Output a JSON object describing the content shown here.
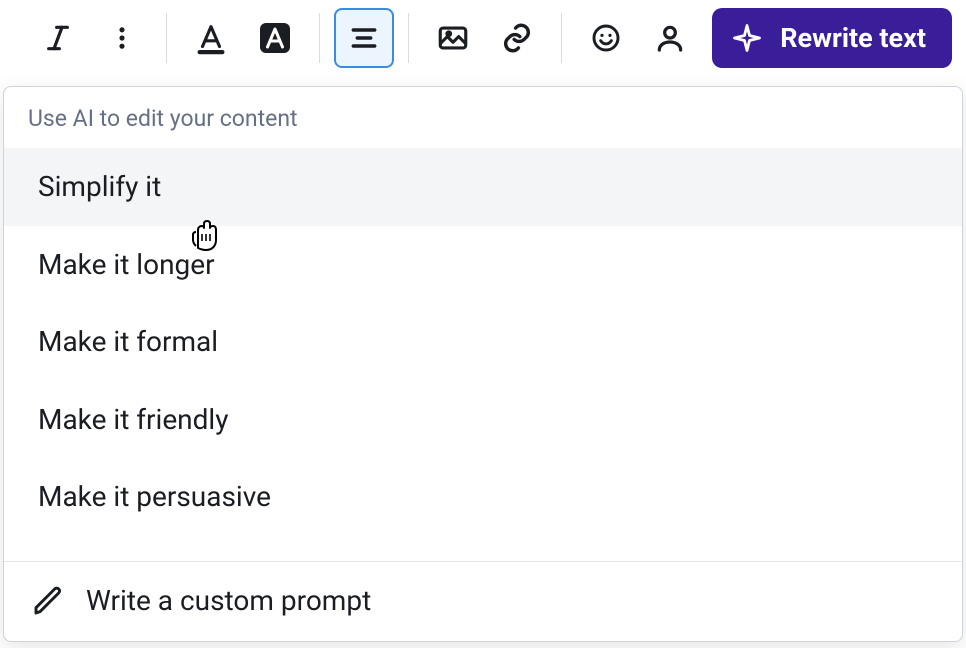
{
  "toolbar": {
    "rewrite_label": "Rewrite text"
  },
  "dropdown": {
    "header": "Use AI to edit your content",
    "items": [
      "Simplify it",
      "Make it longer",
      "Make it formal",
      "Make it friendly",
      "Make it persuasive"
    ],
    "custom_prompt_label": "Write a custom prompt"
  }
}
